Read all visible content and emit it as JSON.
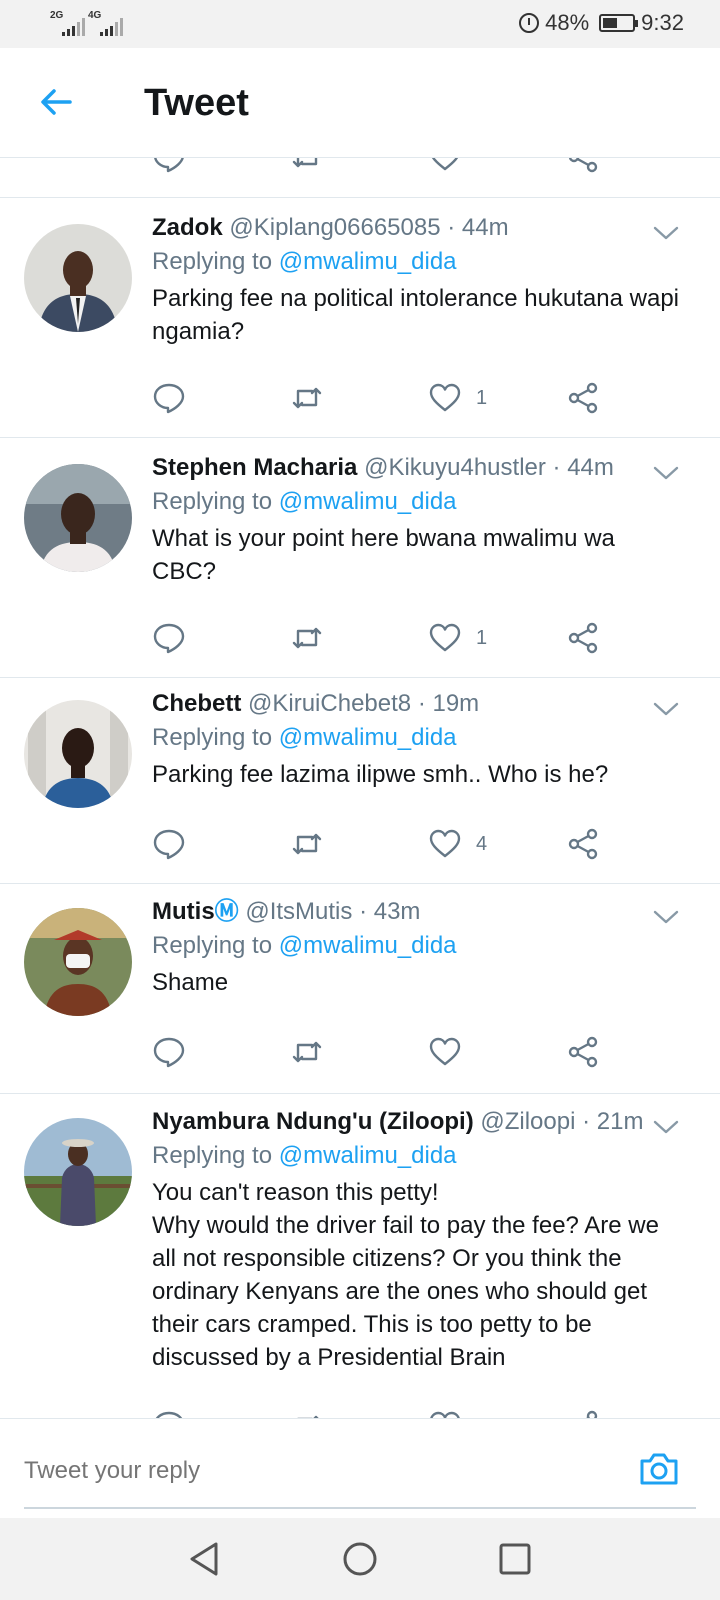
{
  "status_bar": {
    "sim1_label": "2G",
    "sim2_label": "4G",
    "battery_percent": "48%",
    "time": "9:32"
  },
  "header": {
    "title": "Tweet"
  },
  "tweets": [
    {
      "name": "Zadok",
      "verified": false,
      "handle": "@Kiplang06665085",
      "time": "· 44m",
      "replying_prefix": "Replying to",
      "replying_to": "@mwalimu_dida",
      "text": "Parking fee na political intolerance hukutana wapi ngamia?",
      "likes": "1"
    },
    {
      "name": "Stephen Macharia",
      "verified": false,
      "handle": "@Kikuyu4hustler",
      "time": "· 44m",
      "replying_prefix": "Replying to",
      "replying_to": "@mwalimu_dida",
      "text": "What is your point here bwana mwalimu wa CBC?",
      "likes": "1"
    },
    {
      "name": "Chebett",
      "verified": false,
      "handle": "@KiruiChebet8",
      "time": "· 19m",
      "replying_prefix": "Replying to",
      "replying_to": "@mwalimu_dida",
      "text": "Parking fee lazima ilipwe smh.. Who is he?",
      "likes": "4"
    },
    {
      "name": "Mutis",
      "verified": true,
      "verified_glyph": "Ⓜ",
      "handle": "@ItsMutis",
      "time": "· 43m",
      "replying_prefix": "Replying to",
      "replying_to": "@mwalimu_dida",
      "text": "Shame",
      "likes": ""
    },
    {
      "name": "Nyambura Ndung'u (Ziloopi)",
      "verified": false,
      "handle": "@Ziloopi",
      "time": "· 21m",
      "replying_prefix": "Replying to",
      "replying_to": "@mwalimu_dida",
      "text": "You can't reason this petty!\nWhy would the driver fail to pay the fee? Are we all not responsible citizens? Or you think the ordinary Kenyans are the ones who should get their cars cramped. This is too petty to be discussed by a Presidential Brain",
      "likes": ""
    }
  ],
  "reply_bar": {
    "placeholder": "Tweet your reply"
  },
  "colors": {
    "accent": "#1da1f2",
    "icon_gray": "#657786",
    "text": "#14171a"
  }
}
